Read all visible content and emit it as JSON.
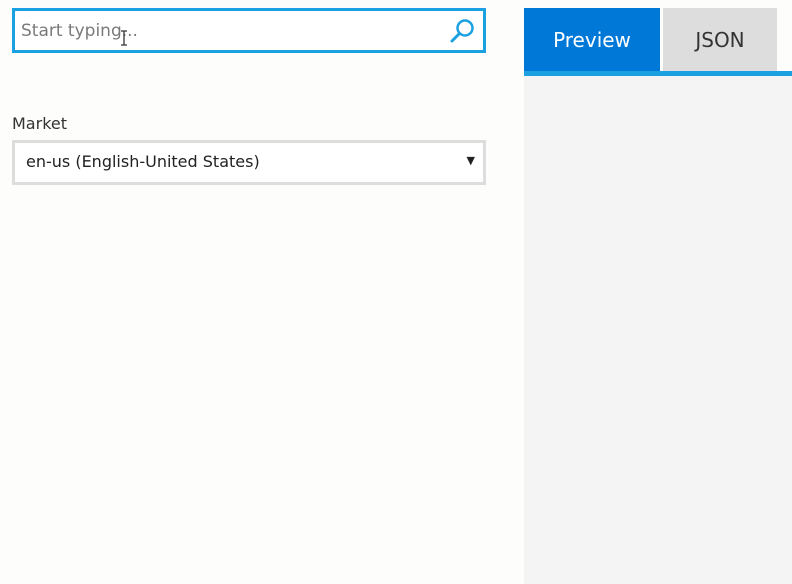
{
  "search": {
    "placeholder": "Start typing...",
    "value": ""
  },
  "market": {
    "label": "Market",
    "selected": "en-us (English-United States)"
  },
  "tabs": [
    {
      "label": "Preview",
      "active": true
    },
    {
      "label": "JSON",
      "active": false
    }
  ],
  "colors": {
    "accent": "#1ba1e2",
    "tab_active": "#0078d7",
    "tab_inactive": "#dddddd",
    "panel_bg": "#f4f4f4"
  }
}
